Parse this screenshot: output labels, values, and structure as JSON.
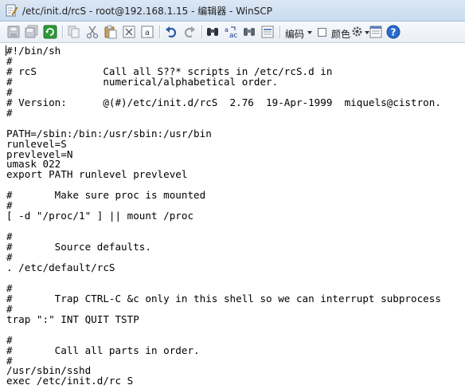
{
  "window": {
    "title": "/etc/init.d/rcS - root@192.168.1.15 - 编辑器 - WinSCP"
  },
  "toolbar": {
    "encoding_label": "编码",
    "color_label": "颜色",
    "icons": [
      "save-icon",
      "save-all-icon",
      "reload-icon",
      "copy-icon",
      "cut-icon",
      "paste-icon",
      "delete-icon",
      "select-all-icon",
      "undo-icon",
      "redo-icon",
      "find-icon",
      "replace-icon",
      "find-next-icon",
      "goto-line-icon",
      "settings-icon",
      "help-icon"
    ]
  },
  "editor": {
    "lines": [
      "#!/bin/sh",
      "#",
      "# rcS           Call all S??* scripts in /etc/rcS.d in",
      "#               numerical/alphabetical order.",
      "#",
      "# Version:      @(#)/etc/init.d/rcS  2.76  19-Apr-1999  miquels@cistron.",
      "#",
      "",
      "PATH=/sbin:/bin:/usr/sbin:/usr/bin",
      "runlevel=S",
      "prevlevel=N",
      "umask 022",
      "export PATH runlevel prevlevel",
      "",
      "#       Make sure proc is mounted",
      "#",
      "[ -d \"/proc/1\" ] || mount /proc",
      "",
      "#",
      "#       Source defaults.",
      "#",
      ". /etc/default/rcS",
      "",
      "#",
      "#       Trap CTRL-C &c only in this shell so we can interrupt subprocess",
      "#",
      "trap \":\" INT QUIT TSTP",
      "",
      "#",
      "#       Call all parts in order.",
      "#",
      "/usr/sbin/sshd",
      "exec /etc/init.d/rc S"
    ]
  }
}
